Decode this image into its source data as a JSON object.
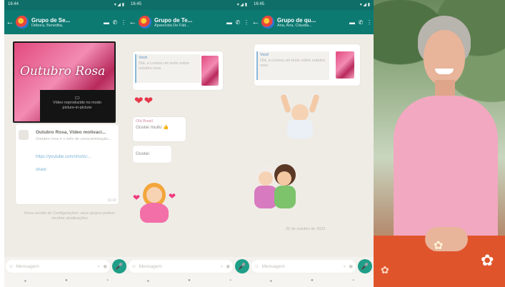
{
  "status_times": [
    "16:44",
    "16:45",
    "16:45"
  ],
  "screens": [
    {
      "group_title": "Grupo de Se...",
      "group_subtitle": "Débora, Benedita,",
      "banner_text": "Outubro Rosa",
      "video_caption": "Vídeo reproduzido no modo picture-in-picture",
      "link_title": "Outubro Rosa, Vídeo motivaci...",
      "link_desc": "Outubro rosa é o mês de conscientização...",
      "link_url": "https://youtube.com/shorts/...",
      "link_tag": "share",
      "msg_time": "16:42",
      "system_note": "Nova versão de Configurações: seus grupos podem receber atualizações"
    },
    {
      "group_title": "Grupo de Te...",
      "group_subtitle": "Aparecida De Fáti...",
      "reply_sender": "Você",
      "reply_text": "Olá, a Lorena um texto sobre outubro rosa",
      "hearts": "❤❤",
      "msg2_sender": "Olá Brasil",
      "msg2_text": "Gostei muito 👍",
      "msg3_text": "Gostei",
      "sticker_note": ""
    },
    {
      "group_title": "Grupo de qu...",
      "group_subtitle": "Ana, Ana, Cláudia...",
      "reply_sender": "Você",
      "reply_text": "Olá, a Lorena um texto sobre outubro rosa",
      "footer_date": "25 de outubro de 2022"
    }
  ],
  "input_placeholder": "Mensagem",
  "icons": {
    "back": "←",
    "video": "▬",
    "call": "✆",
    "menu": "⋮",
    "emoji": "☺",
    "attach": "⌁",
    "camera": "◉",
    "mic": "🎤",
    "nav_back": "◂",
    "nav_home": "●",
    "nav_recent": "▪"
  },
  "colors": {
    "header": "#0d7a72",
    "accent_mic": "#1f9e88",
    "pink": "#e24a7d"
  }
}
